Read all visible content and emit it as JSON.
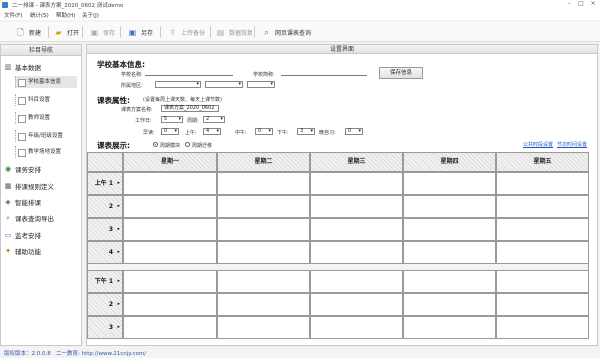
{
  "window": {
    "title": "二一排课 - 课表方案_2020_0602 测试demo"
  },
  "menu": [
    "文件(F)",
    "统计(S)",
    "帮助(H)",
    "关于(J)"
  ],
  "toolbar": [
    {
      "label": "新建",
      "icon": "new-file-icon",
      "disabled": false
    },
    {
      "label": "打开",
      "icon": "open-folder-icon",
      "disabled": false
    },
    {
      "label": "保存",
      "icon": "save-icon",
      "disabled": true
    },
    {
      "label": "另存",
      "icon": "save-as-icon",
      "disabled": false
    },
    {
      "label": "上传备份",
      "icon": "upload-icon",
      "disabled": true
    },
    {
      "label": "数据恢复",
      "icon": "restore-icon",
      "disabled": true
    },
    {
      "label": "网页课表查询",
      "icon": "web-search-icon",
      "disabled": false
    }
  ],
  "sidebar": {
    "title": "栏目导航",
    "groups": [
      {
        "label": "基本数据",
        "icon": "book-icon",
        "items": [
          "学校基本信息",
          "科目设置",
          "教师设置",
          "年级/班级设置",
          "教学场地设置"
        ]
      },
      {
        "label": "课务安排",
        "icon": "globe-icon"
      },
      {
        "label": "排课规则定义",
        "icon": "rules-icon"
      },
      {
        "label": "智能排课",
        "icon": "smart-icon"
      },
      {
        "label": "课表查询导出",
        "icon": "search-icon"
      },
      {
        "label": "监考安排",
        "icon": "monitor-icon"
      },
      {
        "label": "辅助功能",
        "icon": "tools-icon"
      }
    ]
  },
  "main": {
    "title": "设置界面",
    "school": {
      "heading": "学校基本信息:",
      "name_label": "学校名称:",
      "short_label": "学校简称:",
      "region_label": "所属地区:",
      "save_button": "保存信息"
    },
    "props": {
      "heading": "课表属性:",
      "note": "(设置每周上课天数、每天上课节数)",
      "plan_label": "课表方案名称:",
      "plan_value": "课表方案_2020_0602",
      "workday_label": "工作日:",
      "workday_value": "5",
      "cycle_label": "周期:",
      "cycle_value": "2",
      "morning_read_label": "早读:",
      "morning_read_value": "0",
      "am_label": "上午:",
      "am_value": "4",
      "noon_label": "中午:",
      "noon_value": "0",
      "pm_label": "下午:",
      "pm_value": "3",
      "eve_label": "晚自习:",
      "eve_value": "0"
    },
    "display": {
      "heading": "课表展示:",
      "opt1": "周期模块",
      "opt2": "周期迁移",
      "link1": "公共时段设置",
      "link2": "节次时间设置"
    },
    "grid": {
      "days": [
        "星期一",
        "星期二",
        "星期三",
        "星期四",
        "星期五"
      ],
      "morning": [
        "上午 1",
        "2",
        "3",
        "4"
      ],
      "afternoon": [
        "下午 1",
        "2",
        "3"
      ]
    }
  },
  "status": {
    "version": "版权版本：2.0.0.8",
    "site": "二一教育: http://www.21cnjy.com/"
  }
}
